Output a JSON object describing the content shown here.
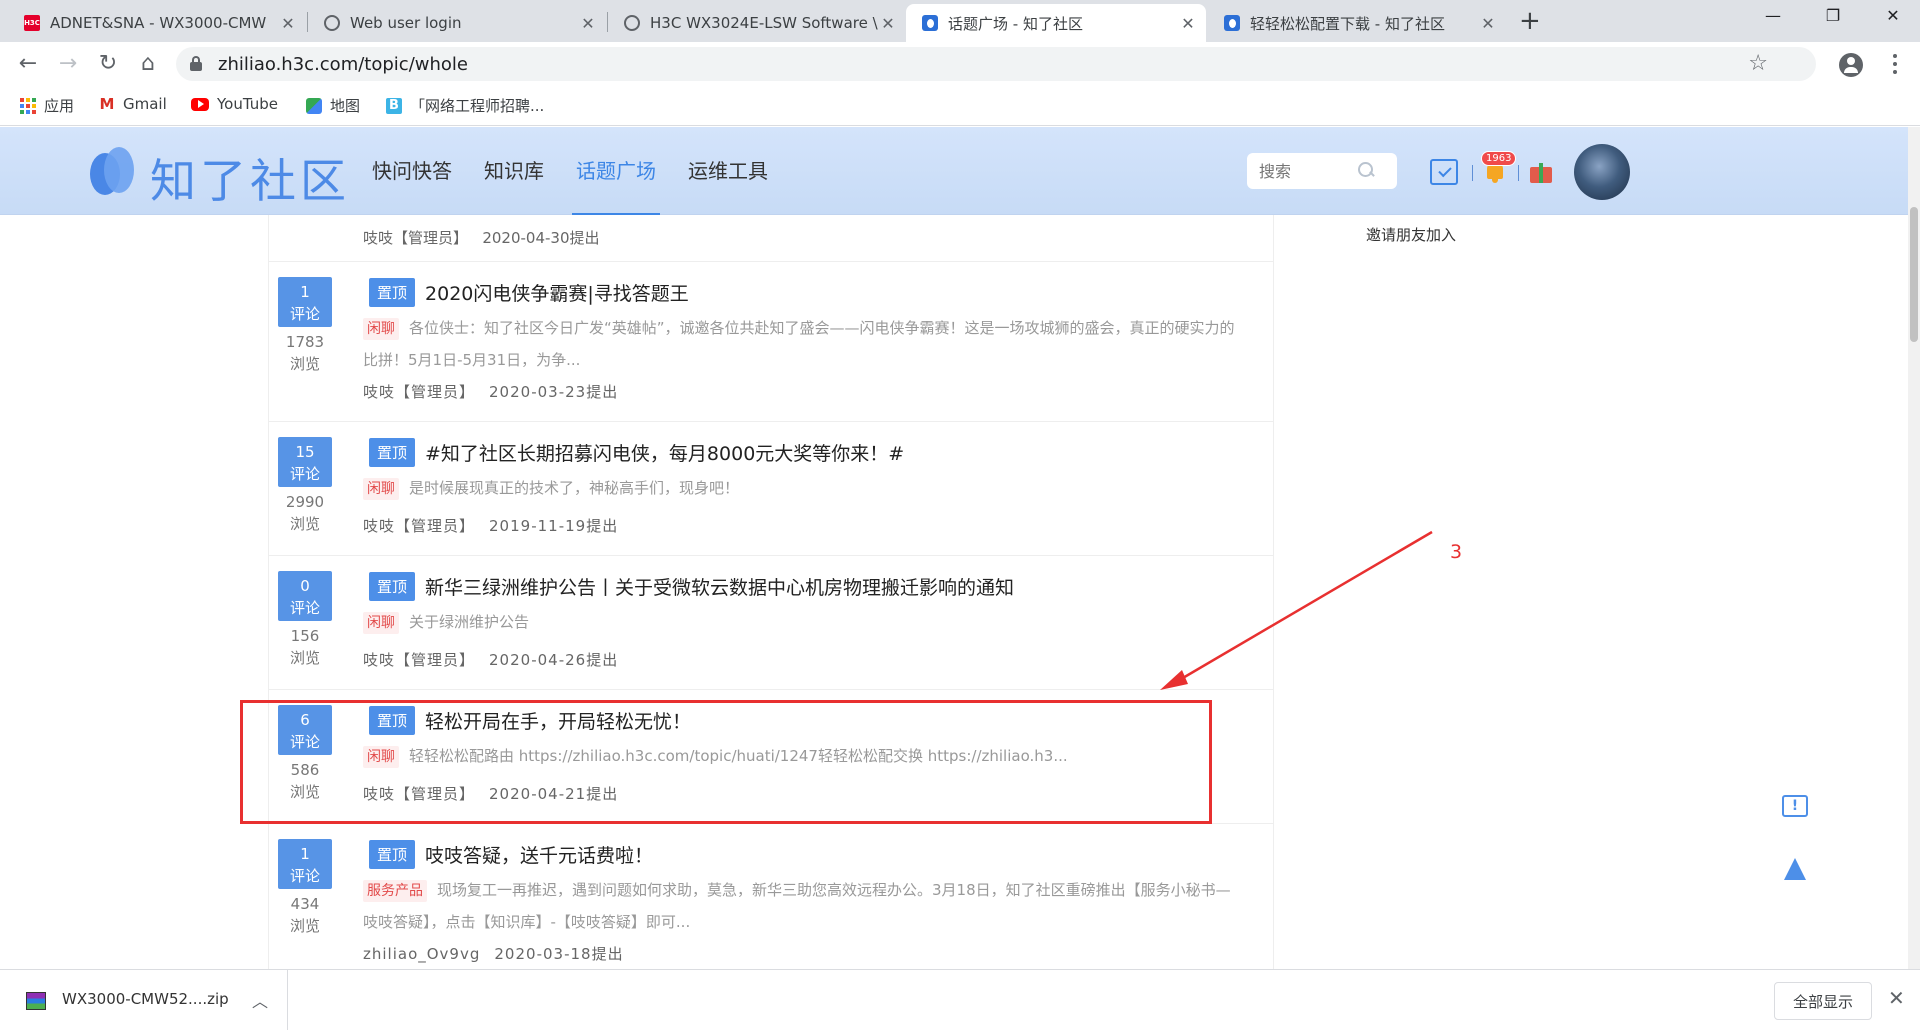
{
  "browser": {
    "tabs": [
      {
        "title": "ADNET&SNA - WX3000-CMW",
        "favicon": "h3c-icon",
        "fav_text": "H3C",
        "active": false
      },
      {
        "title": "Web user login",
        "favicon": "globe-icon",
        "active": false
      },
      {
        "title": "H3C WX3024E-LSW Software \\",
        "favicon": "globe-icon",
        "active": false
      },
      {
        "title": "话题广场 - 知了社区",
        "favicon": "zhiliao-icon",
        "active": true
      },
      {
        "title": "轻轻松松配置下载 - 知了社区",
        "favicon": "zhiliao-icon",
        "active": false
      }
    ],
    "tab_close_glyph": "✕",
    "new_tab_glyph": "+",
    "window_controls": {
      "minimize": "—",
      "restore": "❐",
      "close": "✕"
    },
    "nav": {
      "back": "←",
      "forward": "→",
      "reload": "↻",
      "home": "⌂"
    },
    "url": "zhiliao.h3c.com/topic/whole",
    "star_glyph": "☆",
    "bookmarks": [
      {
        "label": "应用",
        "icon": "apps-icon"
      },
      {
        "label": "Gmail",
        "icon": "gmail-icon",
        "glyph": "M"
      },
      {
        "label": "YouTube",
        "icon": "youtube-icon"
      },
      {
        "label": "地图",
        "icon": "maps-icon"
      },
      {
        "label": "「网络工程师招聘...",
        "icon": "bookmark-b-icon",
        "glyph": "B"
      }
    ]
  },
  "site": {
    "logo_text": "知了社区",
    "nav": [
      {
        "label": "快问快答",
        "active": false
      },
      {
        "label": "知识库",
        "active": false
      },
      {
        "label": "话题广场",
        "active": true
      },
      {
        "label": "运维工具",
        "active": false
      }
    ],
    "search_placeholder": "搜索",
    "notification_count": "1963"
  },
  "sidebar": {
    "invite_label": "邀请朋友加入"
  },
  "fragment_meta": {
    "author": "吱吱【管理员】",
    "date": "2020-04-30提出"
  },
  "topics": [
    {
      "comments": "1",
      "comments_label": "评论",
      "views": "1783",
      "views_label": "浏览",
      "pin": "置顶",
      "title": "2020闪电侠争霸赛|寻找答题王",
      "category": "闲聊",
      "excerpt": "各位侠士：知了社区今日广发“英雄帖”，诚邀各位共赴知了盛会——闪电侠争霸赛！这是一场攻城狮的盛会，真正的硬实力的比拼！5月1日-5月31日，为争...",
      "author": "吱吱【管理员】",
      "date": "2020-03-23提出"
    },
    {
      "comments": "15",
      "comments_label": "评论",
      "views": "2990",
      "views_label": "浏览",
      "pin": "置顶",
      "title": "#知了社区长期招募闪电侠，每月8000元大奖等你来！#",
      "category": "闲聊",
      "excerpt": "是时候展现真正的技术了，神秘高手们，现身吧！",
      "author": "吱吱【管理员】",
      "date": "2019-11-19提出"
    },
    {
      "comments": "0",
      "comments_label": "评论",
      "views": "156",
      "views_label": "浏览",
      "pin": "置顶",
      "title": "新华三绿洲维护公告丨关于受微软云数据中心机房物理搬迁影响的通知",
      "category": "闲聊",
      "excerpt": "关于绿洲维护公告",
      "author": "吱吱【管理员】",
      "date": "2020-04-26提出"
    },
    {
      "comments": "6",
      "comments_label": "评论",
      "views": "586",
      "views_label": "浏览",
      "pin": "置顶",
      "title": "轻松开局在手，开局轻松无忧！",
      "category": "闲聊",
      "excerpt": "轻轻松松配路由 https://zhiliao.h3c.com/topic/huati/1247轻轻松松配交换 https://zhiliao.h3...",
      "author": "吱吱【管理员】",
      "date": "2020-04-21提出"
    },
    {
      "comments": "1",
      "comments_label": "评论",
      "views": "434",
      "views_label": "浏览",
      "pin": "置顶",
      "title": "吱吱答疑，送千元话费啦！",
      "category": "服务产品",
      "excerpt": "现场复工一再推迟，遇到问题如何求助，莫急，新华三助您高效远程办公。3月18日，知了社区重磅推出【服务小秘书—吱吱答疑】，点击【知识库】-【吱吱答疑】即可...",
      "author": "zhiliao_Ov9vg",
      "date": "2020-03-18提出"
    }
  ],
  "annotation": {
    "label": "3",
    "color": "#e83030"
  },
  "floating": {
    "feedback_glyph": "!"
  },
  "downloads": {
    "file_name": "WX3000-CMW52....zip",
    "chevron": "︿",
    "show_all": "全部显示",
    "close": "✕"
  },
  "colors": {
    "accent": "#3d86e6",
    "pin_tag": "#4d8fe8",
    "stat_box": "#5794e6",
    "category_tag": "#e24b4b"
  }
}
